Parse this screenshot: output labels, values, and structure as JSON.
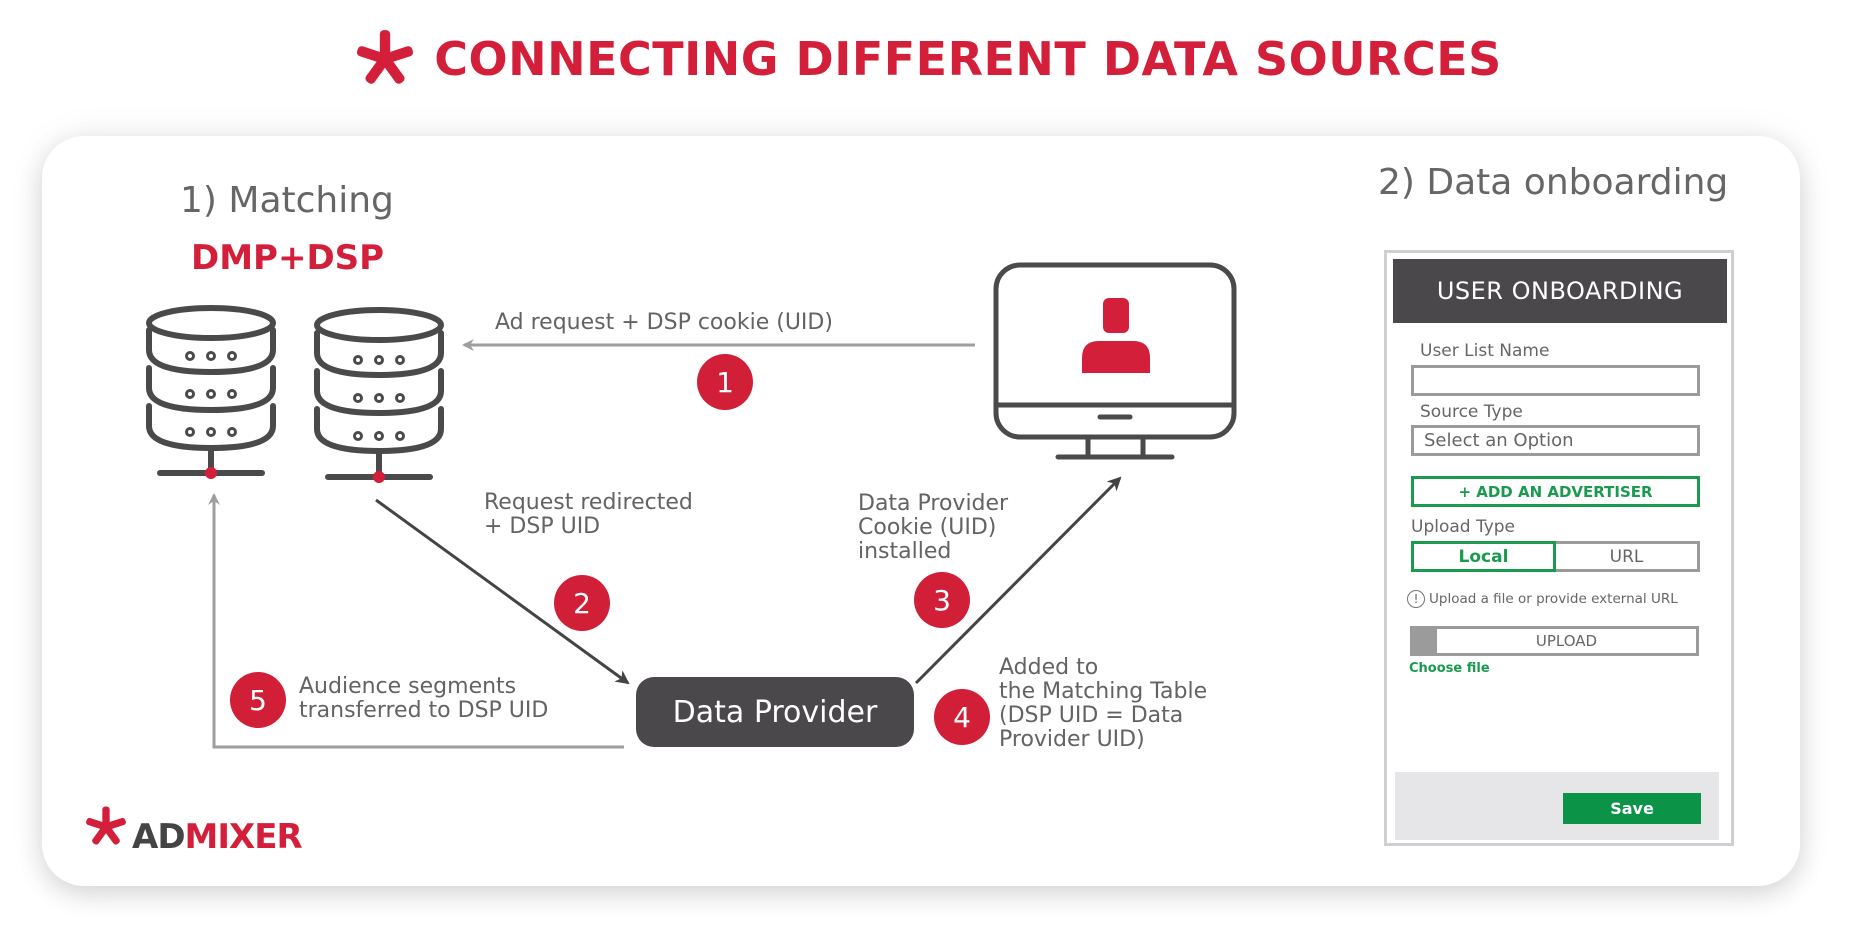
{
  "title": "CONNECTING DIFFERENT DATA SOURCES",
  "colors": {
    "brand_red": "#d31f3a",
    "dark_gray": "#4a484a",
    "text_gray": "#636363",
    "arrow_gray": "#9e9e9e",
    "green": "#1a9a4f",
    "save_green": "#0b9448"
  },
  "matching": {
    "heading": "1) Matching",
    "subheading": "DMP+DSP",
    "icons": [
      "database-server-icon",
      "database-server-icon",
      "monitor-user-icon"
    ]
  },
  "steps": [
    {
      "number": "1",
      "label": "Ad request + DSP cookie (UID)"
    },
    {
      "number": "2",
      "label_lines": [
        "Request redirected",
        "+ DSP UID"
      ]
    },
    {
      "number": "3",
      "label_lines": [
        "Data Provider",
        "Cookie (UID)",
        "installed"
      ]
    },
    {
      "number": "4",
      "label_lines": [
        "Added to",
        "the Matching Table",
        "(DSP UID = Data",
        "Provider UID)"
      ]
    },
    {
      "number": "5",
      "label_lines": [
        "Audience segments",
        "transferred to DSP UID"
      ]
    }
  ],
  "data_provider_label": "Data Provider",
  "onboarding": {
    "heading": "2) Data onboarding",
    "form": {
      "header": "USER ONBOARDING",
      "user_list_name_label": "User List Name",
      "user_list_name_value": "",
      "source_type_label": "Source Type",
      "source_type_value": "Select an Option",
      "add_advertiser_label": "+ ADD AN ADVERTISER",
      "upload_type_label": "Upload Type",
      "upload_type_options": [
        "Local",
        "URL"
      ],
      "upload_type_selected": "Local",
      "info_text": "Upload a file or provide external URL",
      "info_icon": "!",
      "upload_label": "UPLOAD",
      "choose_file_label": "Choose file",
      "save_label": "Save"
    }
  },
  "logo": {
    "part1": "AD",
    "part2": "MIXER"
  }
}
